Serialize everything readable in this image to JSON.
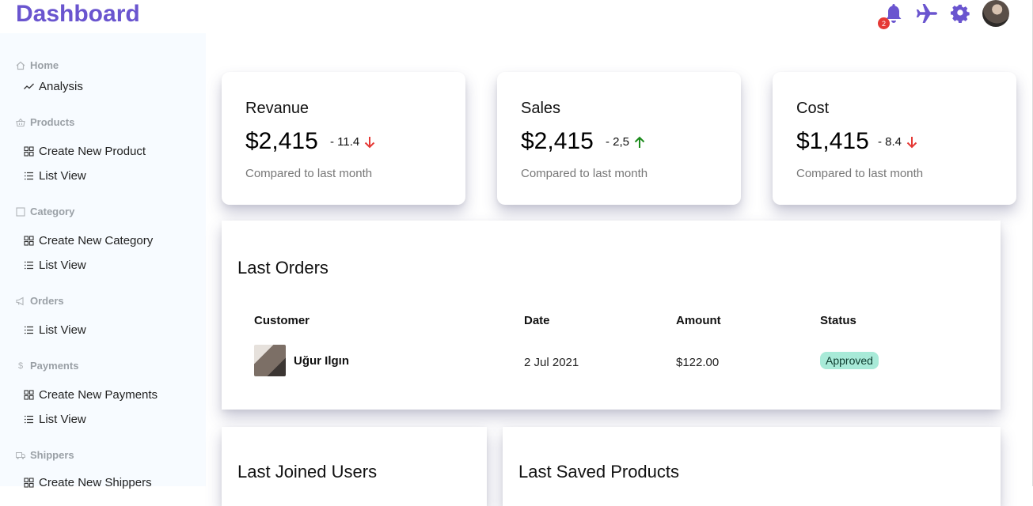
{
  "header": {
    "title": "Dashboard",
    "notifications_count": "2"
  },
  "sidebar": {
    "sections": [
      {
        "label": "Home",
        "icon": "home-icon",
        "items": [
          {
            "label": "Analysis",
            "icon": "trend-icon"
          }
        ]
      },
      {
        "label": "Products",
        "icon": "basket-icon",
        "items": [
          {
            "label": "Create New Product",
            "icon": "grid-icon"
          },
          {
            "label": "List View",
            "icon": "list-icon"
          }
        ]
      },
      {
        "label": "Category",
        "icon": "square-icon",
        "items": [
          {
            "label": "Create New Category",
            "icon": "grid-icon"
          },
          {
            "label": "List View",
            "icon": "list-icon"
          }
        ]
      },
      {
        "label": "Orders",
        "icon": "megaphone-icon",
        "items": [
          {
            "label": "List View",
            "icon": "list-icon"
          }
        ]
      },
      {
        "label": "Payments",
        "icon": "dollar-icon",
        "items": [
          {
            "label": "Create New Payments",
            "icon": "grid-icon"
          },
          {
            "label": "List View",
            "icon": "list-icon"
          }
        ]
      },
      {
        "label": "Shippers",
        "icon": "truck-icon",
        "items": [
          {
            "label": "Create New Shippers",
            "icon": "grid-icon"
          }
        ]
      }
    ]
  },
  "kpis": [
    {
      "title": "Revanue",
      "value": "$2,415",
      "delta": "- 11.4",
      "direction": "down",
      "note": "Compared to last month"
    },
    {
      "title": "Sales",
      "value": "$2,415",
      "delta": "- 2,5",
      "direction": "up",
      "note": "Compared to last month"
    },
    {
      "title": "Cost",
      "value": "$1,415",
      "delta": "- 8.4",
      "direction": "down",
      "note": "Compared to last month"
    }
  ],
  "orders": {
    "title": "Last Orders",
    "columns": [
      "Customer",
      "Date",
      "Amount",
      "Status"
    ],
    "rows": [
      {
        "customer": "Uğur Ilgın",
        "date": "2 Jul 2021",
        "amount": "$122.00",
        "status": "Approved"
      }
    ]
  },
  "panels": {
    "users_title": "Last Joined Users",
    "products_title": "Last Saved Products"
  },
  "colors": {
    "brand": "#6a55cf",
    "down": "#e53935",
    "up": "#1b8a1b",
    "status_bg": "#a8ead8"
  }
}
